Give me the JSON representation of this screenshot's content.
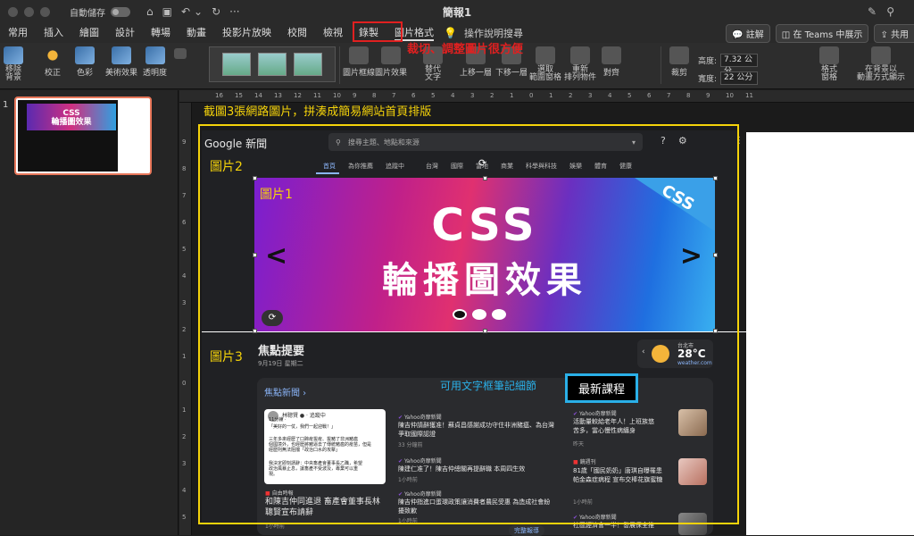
{
  "window": {
    "autosave_label": "自動儲存",
    "title": "簡報1"
  },
  "tabs": [
    "常用",
    "插入",
    "繪圖",
    "設計",
    "轉場",
    "動畫",
    "投影片放映",
    "校閱",
    "檢視",
    "錄製",
    "圖片格式"
  ],
  "tell_me": "操作說明搜尋",
  "tabbar_right": {
    "comment": "註解",
    "teams": "在 Teams 中展示",
    "share": "共用"
  },
  "ribbon": {
    "remove_bg": "移除\n背景",
    "corrections": "校正",
    "color": "色彩",
    "artistic": "美術效果",
    "transparency": "透明度",
    "border": "圖片框線",
    "effects": "圖片效果",
    "alt_text": "替代\n文字",
    "bring_forward": "上移一層",
    "send_backward": "下移一層",
    "selection_pane": "選取\n範圍窗格",
    "rearrange": "重新\n排列物件",
    "align": "對齊",
    "crop": "裁剪",
    "height_label": "高度:",
    "height_value": "7.32 公分",
    "width_label": "寬度:",
    "width_value": "22 公分",
    "format_pane": "格式\n窗格",
    "bg_stack": "在背景以\n動畫方式顯示"
  },
  "annotations": {
    "ribbon_note": "裁切、調整圖片很方便",
    "slide_caption": "截圖3張網路圖片，拼湊成簡易網站首頁排版",
    "pic1": "圖片1",
    "pic2": "圖片2",
    "pic3": "圖片3",
    "textbox_note": "可用文字框筆記細節",
    "latest_course": "最新課程"
  },
  "slide_number": "1",
  "thumbnail": {
    "line1": "CSS",
    "line2": "輪播圖效果"
  },
  "gnews": {
    "logo": "Google 新聞",
    "search_placeholder": "搜尋主題、地點和來源",
    "nav": [
      "首頁",
      "為你推薦",
      "追蹤中",
      "台灣",
      "國際",
      "當地",
      "商業",
      "科學與科技",
      "娛樂",
      "體育",
      "健康"
    ],
    "focus_title": "焦點提要",
    "focus_date": "9月19日 星期二",
    "weather_city": "台北市",
    "weather_temp": "28°C",
    "weather_src": "weather.com",
    "panel_head": "焦點新聞  ›",
    "post_author": "林聰賢 ● · 追蹤中",
    "post_lines": [
      "11分鐘 · ",
      "「美好的一仗，我們一起迎戰！」",
      "三年多來經歷了口蹄疫拔疫、拔豬了非洲豬瘟",
      "個國境外，也經歷將豬逼去了傳統豬瘟的疫苗，但是",
      "經歷則無法阻擋「政治口水的攻擊」",
      "我決定即刻請辭：中央畜產會董事長乙職，希望",
      "政治風暴止息，讓畜產不受波及，專業可以重",
      "現。"
    ],
    "left_src": "自由時報",
    "left_headline": "和陳吉仲同進退 畜產會董事長林聰賢宣布請辭",
    "left_time": "1小時前",
    "mid_items": [
      {
        "src": "Yahoo奇摩新聞",
        "text1": "陳吉仲請辭獲准！蘇貞昌感謝成功守住非洲豬瘟、為台灣",
        "text2": "爭取國際認證",
        "time": "33 分鐘前"
      },
      {
        "src": "Yahoo奇摩新聞",
        "text1": "陳建仁准了！陳吉仲總閣再提辭職 本周四生效",
        "text2": "",
        "time": "1小時前"
      },
      {
        "src": "Yahoo奇摩新聞",
        "text1": "陳吉仲指進口蛋環政策讓消費者農民受惠 為造成社會紛",
        "text2": "擾致歉",
        "time": "1小時前"
      }
    ],
    "right_items": [
      {
        "src": "Yahoo奇摩新聞",
        "text1": "活動量較給老年人！上班族悠",
        "text2": "苦多，當心慢性病纏身",
        "time": "昨天"
      },
      {
        "src": "鏡週刊",
        "text1": "81歲「國民奶奶」唐琪自曝罹患",
        "text2": "帕金森症病程 宣布交棒花旗蜜糖",
        "time": "1小時前"
      },
      {
        "src": "Yahoo奇摩新聞",
        "text1": "社區經濟會一半！發展保全推",
        "text2": "",
        "time": ""
      }
    ],
    "full_coverage": "完整報導"
  },
  "carousel": {
    "tag": "CSS",
    "line1": "CSS",
    "line2": "輪播圖效果"
  },
  "ruler_h": [
    "16",
    "15",
    "14",
    "13",
    "12",
    "11",
    "10",
    "9",
    "8",
    "7",
    "6",
    "5",
    "4",
    "3",
    "2",
    "1",
    "0",
    "1",
    "2",
    "3",
    "4",
    "5",
    "6",
    "7",
    "8",
    "9",
    "10",
    "11"
  ],
  "ruler_v": [
    "9",
    "8",
    "7",
    "6",
    "5",
    "4",
    "3",
    "2",
    "1",
    "0",
    "1",
    "2",
    "3",
    "4",
    "5"
  ],
  "colors": {
    "annotation_yellow": "#f5d30a",
    "annotation_red": "#e02020",
    "annotation_blue": "#2ab0e8",
    "selection_orange": "#e8775a"
  }
}
